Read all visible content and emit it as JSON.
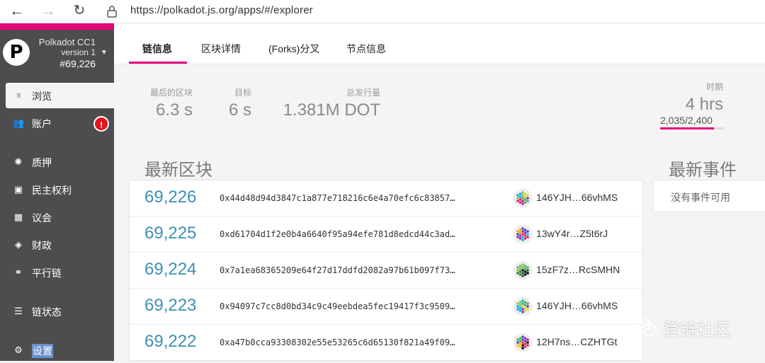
{
  "browser": {
    "url": "https://polkadot.js.org/apps/#/explorer",
    "back_icon": "arrow-left-icon",
    "forward_icon": "arrow-right-icon",
    "reload_icon": "reload-icon"
  },
  "sidebar": {
    "chain_name": "Polkadot CC1",
    "chain_version": "version 1",
    "best_block": "#69,226",
    "items": [
      {
        "label": "浏览",
        "icon": "grid-icon"
      },
      {
        "label": "账户",
        "icon": "users-icon",
        "badge": "!"
      },
      {
        "label": "质押",
        "icon": "certificate-icon"
      },
      {
        "label": "民主权利",
        "icon": "calendar-check-icon"
      },
      {
        "label": "议会",
        "icon": "building-icon"
      },
      {
        "label": "财政",
        "icon": "gem-icon"
      },
      {
        "label": "平行链",
        "icon": "link-icon"
      },
      {
        "label": "链状态",
        "icon": "database-icon"
      },
      {
        "label": "设置",
        "icon": "cogs-icon"
      }
    ]
  },
  "tabs": [
    {
      "label": "链信息"
    },
    {
      "label": "区块详情"
    },
    {
      "label": "(Forks)分叉"
    },
    {
      "label": "节点信息"
    }
  ],
  "stats": {
    "last_block_label": "最后的区块",
    "last_block_value": "6.3 s",
    "target_label": "目标",
    "target_value": "6 s",
    "issuance_label": "总发行量",
    "issuance_value": "1.381M DOT",
    "epoch_label": "时期",
    "epoch_value": "4 hrs",
    "epoch_progress_text": "2,035/2,400",
    "epoch_progress_fraction": 0.848
  },
  "recent_blocks": {
    "title": "最新区块",
    "rows": [
      {
        "number": "69,226",
        "hash": "0x44d48d94d3847c1a877e718216c6e4a70efc6c83857…",
        "author": "146YJH…66vhMS"
      },
      {
        "number": "69,225",
        "hash": "0xd61704d1f2e0b4a6640f95a94efe781d8edcd44c3ad…",
        "author": "13wY4r…Z5t6rJ"
      },
      {
        "number": "69,224",
        "hash": "0x7a1ea68365209e64f27d17ddfd2082a97b61b097f73…",
        "author": "15zF7z…RcSMHN"
      },
      {
        "number": "69,223",
        "hash": "0x94097c7cc8d0bd34c9c49eebdea5fec19417f3c9509…",
        "author": "146YJH…66vhMS"
      },
      {
        "number": "69,222",
        "hash": "0xa47b0cca93308302e55e53265c6d65130f821a49f09…",
        "author": "12H7ns…CZHTGt"
      }
    ]
  },
  "recent_events": {
    "title": "最新事件",
    "empty_text": "没有事件可用"
  },
  "watermark": {
    "text": "登链社区"
  },
  "colors": {
    "accent": "#e6007a",
    "sidebar_bg": "#4d4d4d",
    "block_number": "#3d8fb3",
    "badge": "#e0171f"
  }
}
